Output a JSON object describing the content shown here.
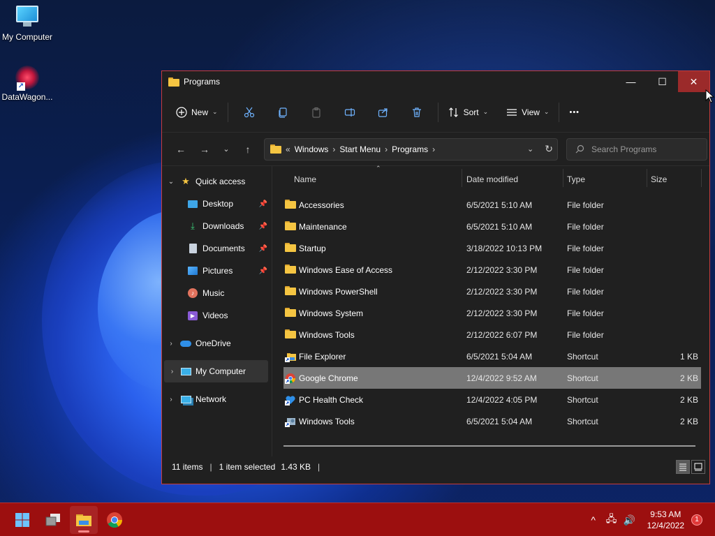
{
  "desktop": {
    "icons": [
      {
        "label": "My Computer",
        "icon": "monitor-icon"
      },
      {
        "label": "DataWagon...",
        "icon": "datawagon-logo-icon"
      }
    ]
  },
  "window": {
    "title": "Programs",
    "controls": {
      "minimize": "—",
      "maximize": "☐",
      "close": "✕"
    }
  },
  "toolbar": {
    "new_label": "New",
    "sort_label": "Sort",
    "view_label": "View",
    "more_label": "•••"
  },
  "address": {
    "overflow": "«",
    "crumbs": [
      "Windows",
      "Start Menu",
      "Programs"
    ],
    "search_placeholder": "Search Programs"
  },
  "sidebar": {
    "quick_access": "Quick access",
    "items": [
      {
        "label": "Desktop",
        "icon": "desktop-icon",
        "pinned": true
      },
      {
        "label": "Downloads",
        "icon": "download-icon",
        "pinned": true
      },
      {
        "label": "Documents",
        "icon": "document-icon",
        "pinned": true
      },
      {
        "label": "Pictures",
        "icon": "picture-icon",
        "pinned": true
      },
      {
        "label": "Music",
        "icon": "music-icon",
        "pinned": false
      },
      {
        "label": "Videos",
        "icon": "video-icon",
        "pinned": false
      }
    ],
    "onedrive": "OneDrive",
    "my_computer": "My Computer",
    "network": "Network"
  },
  "columns": {
    "name": "Name",
    "date": "Date modified",
    "type": "Type",
    "size": "Size"
  },
  "files": [
    {
      "name": "Accessories",
      "date": "6/5/2021 5:10 AM",
      "type": "File folder",
      "size": "",
      "icon": "folder-icon"
    },
    {
      "name": "Maintenance",
      "date": "6/5/2021 5:10 AM",
      "type": "File folder",
      "size": "",
      "icon": "folder-icon"
    },
    {
      "name": "Startup",
      "date": "3/18/2022 10:13 PM",
      "type": "File folder",
      "size": "",
      "icon": "folder-icon"
    },
    {
      "name": "Windows Ease of Access",
      "date": "2/12/2022 3:30 PM",
      "type": "File folder",
      "size": "",
      "icon": "folder-icon"
    },
    {
      "name": "Windows PowerShell",
      "date": "2/12/2022 3:30 PM",
      "type": "File folder",
      "size": "",
      "icon": "folder-icon"
    },
    {
      "name": "Windows System",
      "date": "2/12/2022 3:30 PM",
      "type": "File folder",
      "size": "",
      "icon": "folder-icon"
    },
    {
      "name": "Windows Tools",
      "date": "2/12/2022 6:07 PM",
      "type": "File folder",
      "size": "",
      "icon": "folder-icon"
    },
    {
      "name": "File Explorer",
      "date": "6/5/2021 5:04 AM",
      "type": "Shortcut",
      "size": "1 KB",
      "icon": "file-explorer-shortcut-icon"
    },
    {
      "name": "Google Chrome",
      "date": "12/4/2022 9:52 AM",
      "type": "Shortcut",
      "size": "2 KB",
      "icon": "chrome-shortcut-icon",
      "selected": true
    },
    {
      "name": "PC Health Check",
      "date": "12/4/2022 4:05 PM",
      "type": "Shortcut",
      "size": "2 KB",
      "icon": "pc-health-shortcut-icon"
    },
    {
      "name": "Windows Tools",
      "date": "6/5/2021 5:04 AM",
      "type": "Shortcut",
      "size": "2 KB",
      "icon": "windows-tools-shortcut-icon"
    }
  ],
  "status": {
    "items": "11 items",
    "selected": "1 item selected",
    "size": "1.43 KB",
    "trailing_sep": "|"
  },
  "taskbar": {
    "time": "9:53 AM",
    "date": "12/4/2022",
    "notifications": "1"
  },
  "colors": {
    "accent": "#9c0f0f",
    "window_bg": "#202020",
    "selection": "#777777",
    "folder": "#f5c542"
  }
}
